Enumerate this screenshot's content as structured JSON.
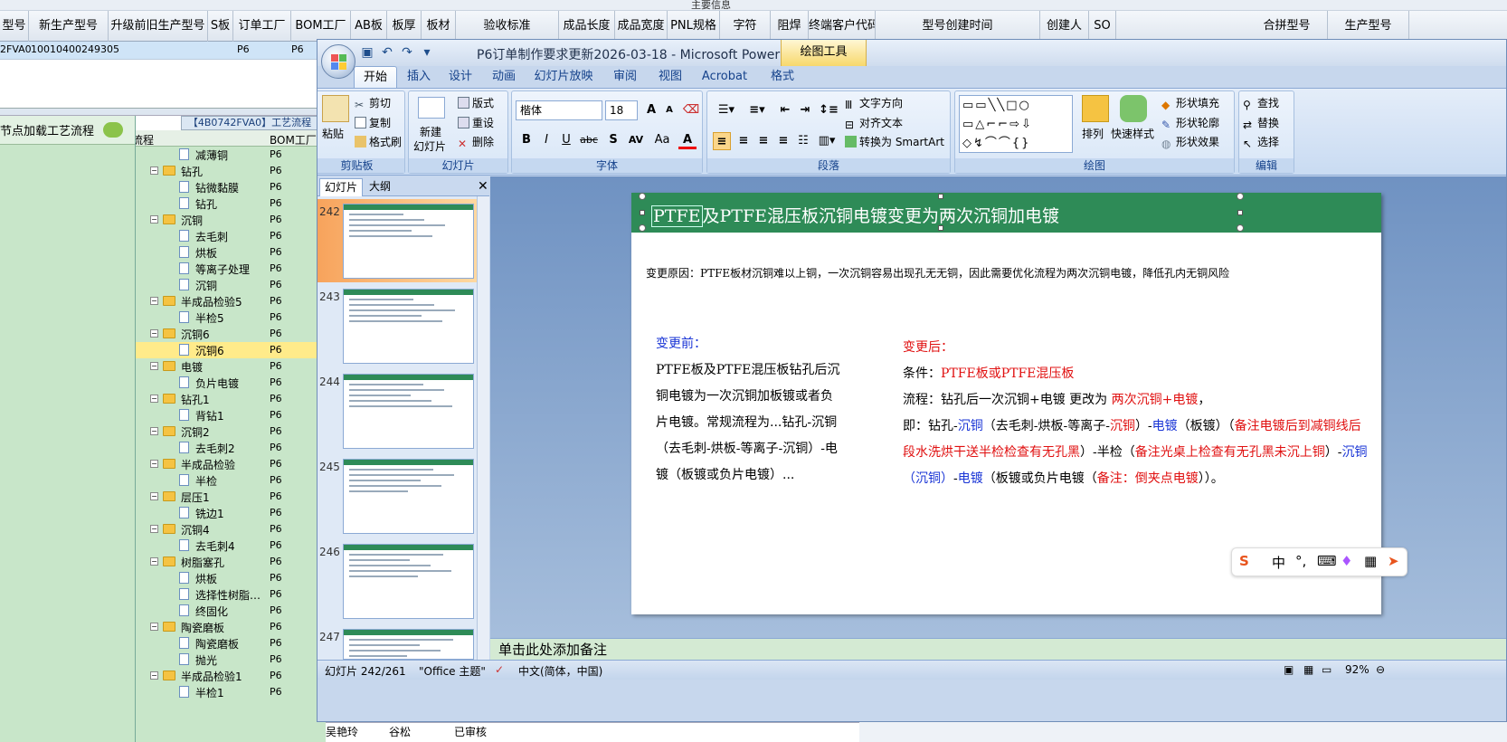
{
  "bg_app": {
    "top_banner": "主要信息",
    "columns": [
      "型号",
      "新生产型号",
      "升级前旧生产型号",
      "S板",
      "订单工厂",
      "BOM工厂",
      "AB板",
      "板厚",
      "板材",
      "验收标准",
      "成品长度",
      "成品宽度",
      "PNL规格",
      "字符",
      "阻焊",
      "终端客户代码",
      "型号创建时间",
      "创建人",
      "SO",
      "合拼型号",
      "生产型号"
    ],
    "row_values": [
      "2FVA0",
      "10010400249305",
      "P6",
      "P6"
    ],
    "process_tab": "【4B0742FVA0】工艺流程",
    "left_heading": "节点加载工艺流程",
    "tree_header": {
      "flow": "流程",
      "bom": "BOM工厂"
    },
    "tree": [
      {
        "label": "减薄铜",
        "kind": "doc",
        "level": 2,
        "p6": "P6"
      },
      {
        "label": "钻孔",
        "kind": "folder",
        "level": 1,
        "p6": "P6"
      },
      {
        "label": "钻微黏膜",
        "kind": "doc",
        "level": 2,
        "p6": "P6"
      },
      {
        "label": "钻孔",
        "kind": "doc",
        "level": 2,
        "p6": "P6"
      },
      {
        "label": "沉铜",
        "kind": "folder",
        "level": 1,
        "p6": "P6"
      },
      {
        "label": "去毛刺",
        "kind": "doc",
        "level": 2,
        "p6": "P6"
      },
      {
        "label": "烘板",
        "kind": "doc",
        "level": 2,
        "p6": "P6"
      },
      {
        "label": "等离子处理",
        "kind": "doc",
        "level": 2,
        "p6": "P6"
      },
      {
        "label": "沉铜",
        "kind": "doc",
        "level": 2,
        "p6": "P6"
      },
      {
        "label": "半成品检验5",
        "kind": "folder",
        "level": 1,
        "p6": "P6"
      },
      {
        "label": "半检5",
        "kind": "doc",
        "level": 2,
        "p6": "P6"
      },
      {
        "label": "沉铜6",
        "kind": "folder",
        "level": 1,
        "p6": "P6"
      },
      {
        "label": "沉铜6",
        "kind": "doc",
        "level": 2,
        "p6": "P6",
        "selected": true
      },
      {
        "label": "电镀",
        "kind": "folder",
        "level": 1,
        "p6": "P6"
      },
      {
        "label": "负片电镀",
        "kind": "doc",
        "level": 2,
        "p6": "P6"
      },
      {
        "label": "钻孔1",
        "kind": "folder",
        "level": 1,
        "p6": "P6"
      },
      {
        "label": "背钻1",
        "kind": "doc",
        "level": 2,
        "p6": "P6"
      },
      {
        "label": "沉铜2",
        "kind": "folder",
        "level": 1,
        "p6": "P6"
      },
      {
        "label": "去毛刺2",
        "kind": "doc",
        "level": 2,
        "p6": "P6"
      },
      {
        "label": "半成品检验",
        "kind": "folder",
        "level": 1,
        "p6": "P6"
      },
      {
        "label": "半检",
        "kind": "doc",
        "level": 2,
        "p6": "P6"
      },
      {
        "label": "层压1",
        "kind": "folder",
        "level": 1,
        "p6": "P6"
      },
      {
        "label": "铣边1",
        "kind": "doc",
        "level": 2,
        "p6": "P6"
      },
      {
        "label": "沉铜4",
        "kind": "folder",
        "level": 1,
        "p6": "P6"
      },
      {
        "label": "去毛刺4",
        "kind": "doc",
        "level": 2,
        "p6": "P6"
      },
      {
        "label": "树脂塞孔",
        "kind": "folder",
        "level": 1,
        "p6": "P6"
      },
      {
        "label": "烘板",
        "kind": "doc",
        "level": 2,
        "p6": "P6"
      },
      {
        "label": "选择性树脂…",
        "kind": "doc",
        "level": 2,
        "p6": "P6"
      },
      {
        "label": "终固化",
        "kind": "doc",
        "level": 2,
        "p6": "P6"
      },
      {
        "label": "陶瓷磨板",
        "kind": "folder",
        "level": 1,
        "p6": "P6"
      },
      {
        "label": "陶瓷磨板",
        "kind": "doc",
        "level": 2,
        "p6": "P6"
      },
      {
        "label": "抛光",
        "kind": "doc",
        "level": 2,
        "p6": "P6"
      },
      {
        "label": "半成品检验1",
        "kind": "folder",
        "level": 1,
        "p6": "P6"
      },
      {
        "label": "半检1",
        "kind": "doc",
        "level": 2,
        "p6": "P6"
      }
    ],
    "bottom_row": [
      "吴艳玲",
      "谷松",
      "已审核"
    ]
  },
  "ppt": {
    "window_title": "P6订单制作要求更新2026-03-18 - Microsoft PowerPoint",
    "context_tab": "绘图工具",
    "tabs": [
      "开始",
      "插入",
      "设计",
      "动画",
      "幻灯片放映",
      "审阅",
      "视图",
      "Acrobat",
      "格式"
    ],
    "ribbon": {
      "clipboard": {
        "paste": "粘贴",
        "cut": "剪切",
        "copy": "复制",
        "format_painter": "格式刷",
        "label": "剪贴板"
      },
      "slides": {
        "new_slide": "新建",
        "new_slide2": "幻灯片",
        "layout": "版式",
        "reset": "重设",
        "delete": "删除",
        "label": "幻灯片"
      },
      "font": {
        "name": "楷体",
        "size": "18",
        "label": "字体",
        "bold": "B",
        "italic": "I",
        "underline": "U",
        "strike": "abc",
        "shadow": "S",
        "spacing": "AV",
        "case": "Aa",
        "color": "A",
        "grow": "A",
        "shrink": "A"
      },
      "paragraph": {
        "direction": "文字方向",
        "align_text": "对齐文本",
        "smartart": "转换为 SmartArt",
        "label": "段落"
      },
      "drawing": {
        "arrange": "排列",
        "quick_styles": "快速样式",
        "shape_fill": "形状填充",
        "shape_outline": "形状轮廓",
        "shape_effects": "形状效果",
        "label": "绘图"
      },
      "editing": {
        "find": "查找",
        "replace": "替换",
        "select": "选择",
        "label": "编辑"
      }
    },
    "pane_tabs": [
      "幻灯片",
      "大纲"
    ],
    "thumbnails": [
      "242",
      "243",
      "244",
      "245",
      "246",
      "247"
    ],
    "slide": {
      "title_prefix": "PTFE",
      "title_rest": "及PTFE混压板沉铜电镀变更为两次沉铜加电镀",
      "reason": "变更原因：PTFE板材沉铜难以上铜，一次沉铜容易出现孔无无铜，因此需要优化流程为两次沉铜电镀，降低孔内无铜风险",
      "before_heading": "变更前：",
      "before_text": "PTFE板及PTFE混压板钻孔后沉铜电镀为一次沉铜加板镀或者负片电镀。常规流程为...钻孔-沉铜（去毛刺-烘板-等离子-沉铜）-电镀（板镀或负片电镀）...",
      "after_heading": "变更后：",
      "cond_label": "条件：",
      "cond_value": "PTFE板或PTFE混压板",
      "flow_label": "流程：钻孔后一次沉铜+电镀 更改为 ",
      "flow_value": "两次沉铜+电镀",
      "flow_end": "，",
      "detail": [
        {
          "t": "即：钻孔-",
          "c": ""
        },
        {
          "t": "沉铜",
          "c": "blue"
        },
        {
          "t": "（去毛刺-烘板-等离子-",
          "c": ""
        },
        {
          "t": "沉铜",
          "c": "red"
        },
        {
          "t": "）-",
          "c": ""
        },
        {
          "t": "电镀",
          "c": "blue"
        },
        {
          "t": "（板镀）（",
          "c": ""
        },
        {
          "t": "备注电镀后到减铜线后段水洗烘干送半检检查有无孔黑",
          "c": "red"
        },
        {
          "t": "）-半检（",
          "c": ""
        },
        {
          "t": "备注光桌上检查有无孔黑未沉上铜",
          "c": "red"
        },
        {
          "t": "）-",
          "c": ""
        },
        {
          "t": "沉铜（沉铜）",
          "c": "blue"
        },
        {
          "t": "-",
          "c": ""
        },
        {
          "t": "电镀",
          "c": "blue"
        },
        {
          "t": "（板镀或负片电镀（",
          "c": ""
        },
        {
          "t": "备注：倒夹点电镀",
          "c": "red"
        },
        {
          "t": "））。",
          "c": ""
        }
      ]
    },
    "notes_placeholder": "单击此处添加备注",
    "status": {
      "slide": "幻灯片 242/261",
      "theme": "\"Office 主题\"",
      "lang": "中文(简体，中国)",
      "zoom": "92%"
    },
    "ime": {
      "mode": "中",
      "punct": "°,"
    }
  }
}
